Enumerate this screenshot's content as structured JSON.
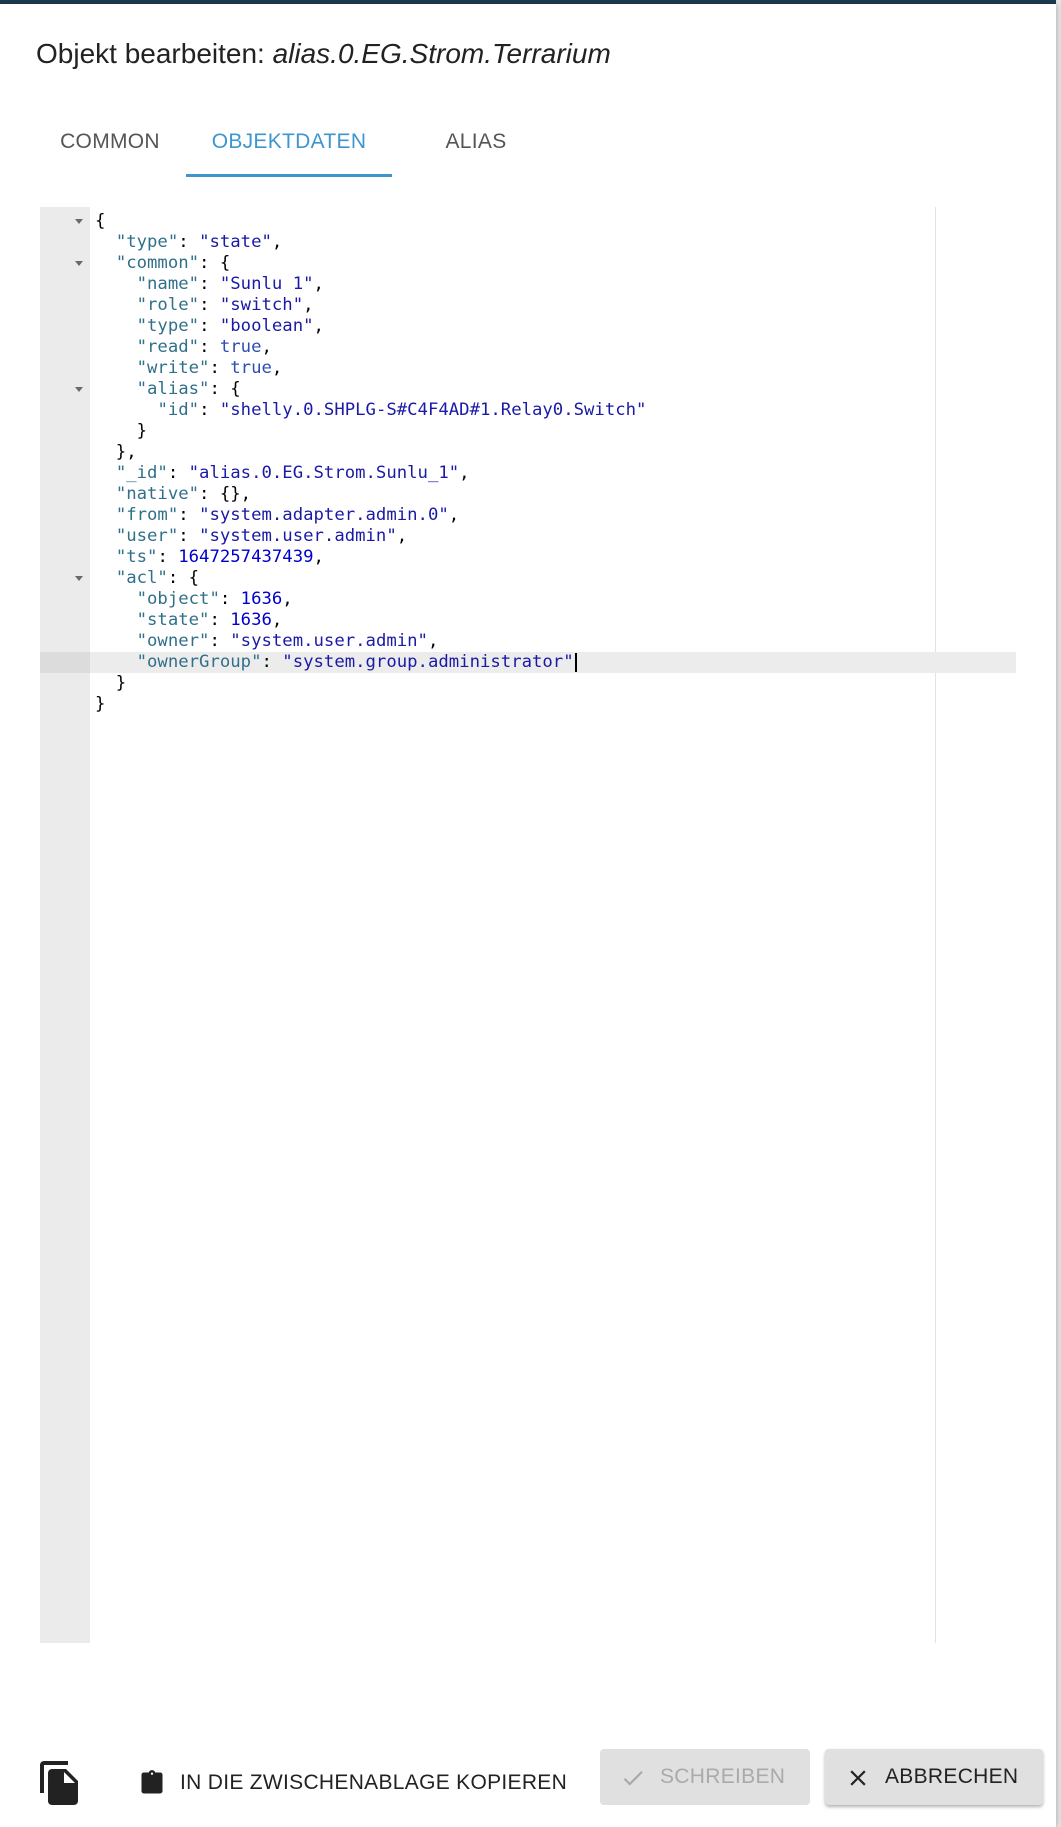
{
  "dialog": {
    "title_prefix": "Objekt bearbeiten: ",
    "object_name": "alias.0.EG.Strom.Terrarium"
  },
  "tabs": [
    {
      "label": "COMMON",
      "active": false
    },
    {
      "label": "OBJEKTDATEN",
      "active": true
    },
    {
      "label": "ALIAS",
      "active": false
    }
  ],
  "editor": {
    "lines": [
      "{",
      "  \"type\": \"state\",",
      "  \"common\": {",
      "    \"name\": \"Sunlu 1\",",
      "    \"role\": \"switch\",",
      "    \"type\": \"boolean\",",
      "    \"read\": true,",
      "    \"write\": true,",
      "    \"alias\": {",
      "      \"id\": \"shelly.0.SHPLG-S#C4F4AD#1.Relay0.Switch\"",
      "    }",
      "  },",
      "  \"_id\": \"alias.0.EG.Strom.Sunlu_1\",",
      "  \"native\": {},",
      "  \"from\": \"system.adapter.admin.0\",",
      "  \"user\": \"system.user.admin\",",
      "  \"ts\": 1647257437439,",
      "  \"acl\": {",
      "    \"object\": 1636,",
      "    \"state\": 1636,",
      "    \"owner\": \"system.user.admin\",",
      "    \"ownerGroup\": \"system.group.administrator\"",
      "  }",
      "}"
    ],
    "fold_lines": [
      0,
      2,
      8,
      17
    ],
    "cursor_line": 21
  },
  "footer": {
    "copy_clipboard_label": "IN DIE ZWISCHENABLAGE KOPIEREN",
    "write_label": "SCHREIBEN",
    "cancel_label": "ABBRECHEN"
  },
  "colors": {
    "accent": "#3e96cf",
    "backdrop": "#1f3c52",
    "json_key": "#31708a",
    "json_string": "#1a1aa6",
    "json_number": "#0000cd",
    "json_boolean": "#2b4eb5"
  }
}
